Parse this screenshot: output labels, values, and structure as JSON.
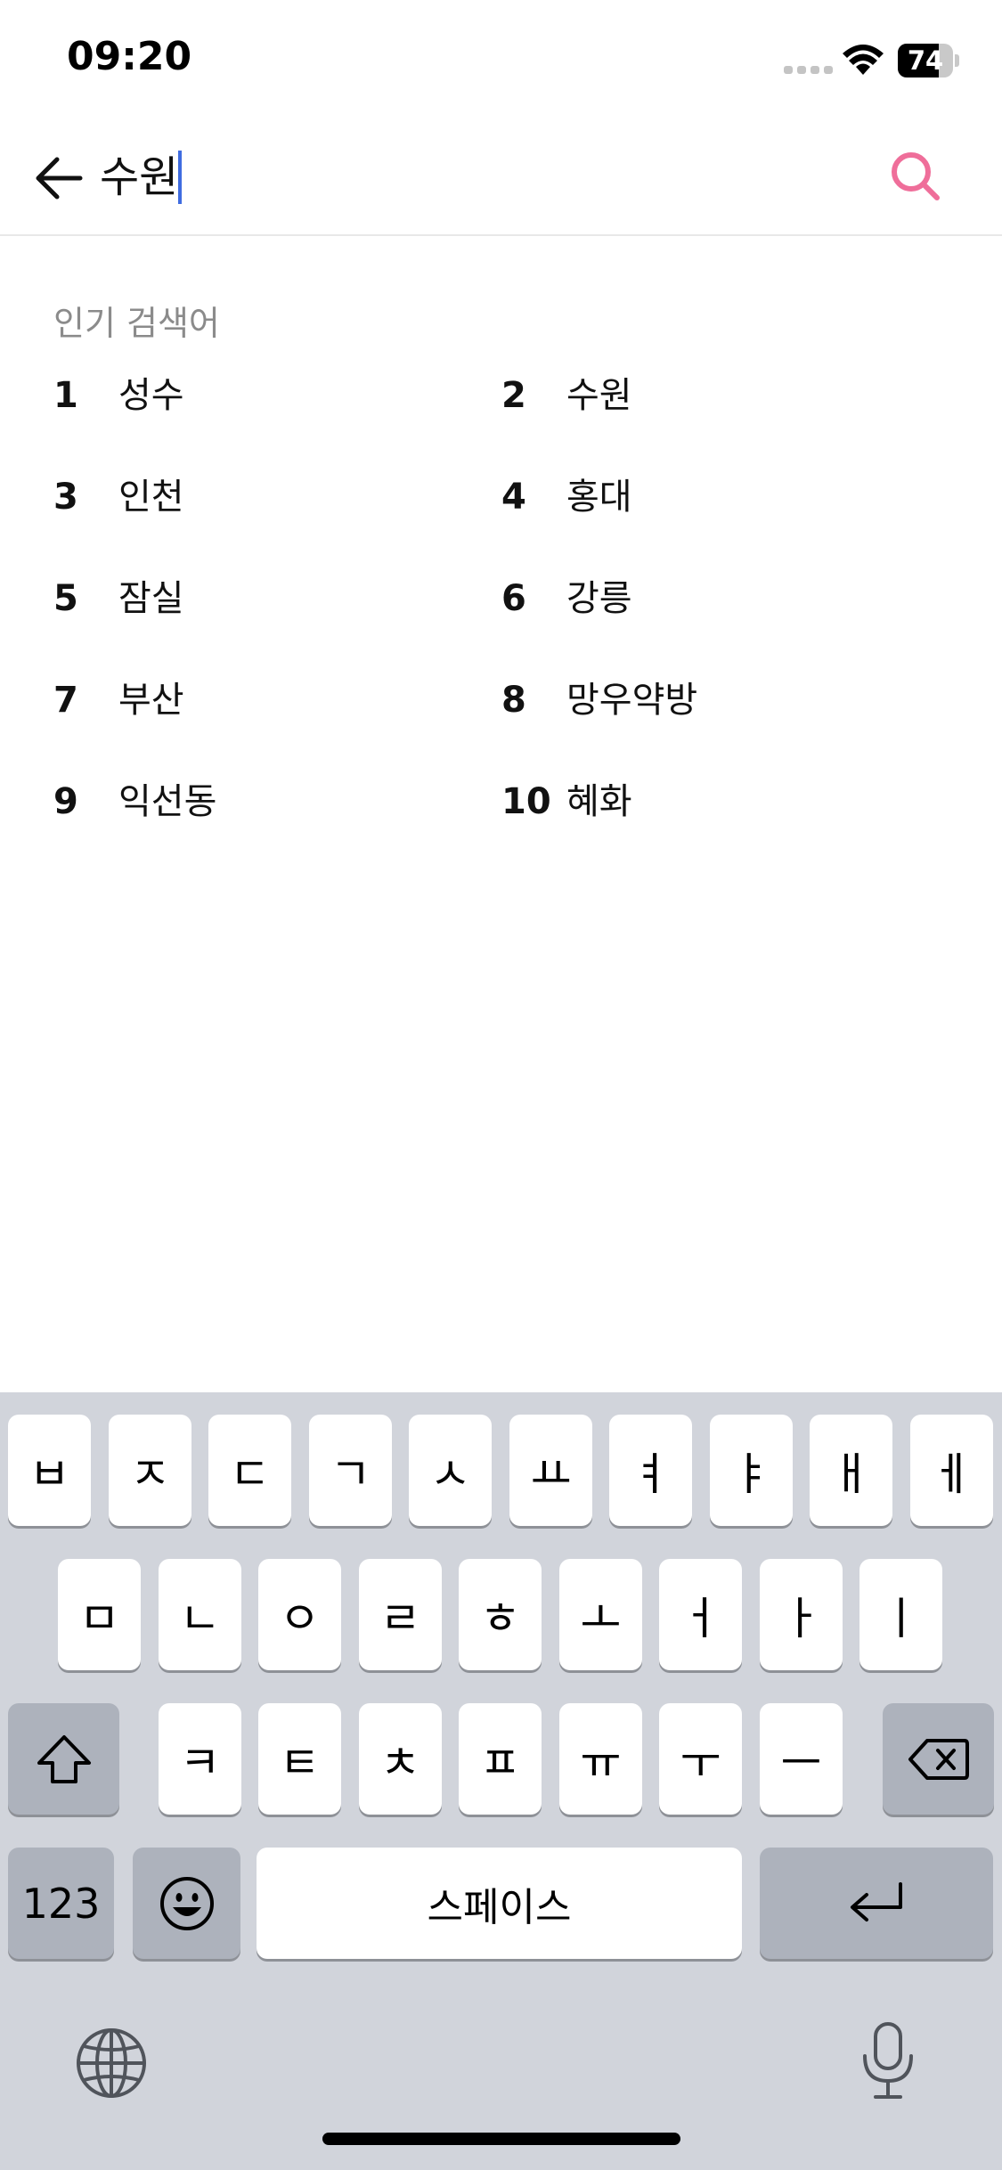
{
  "status_bar": {
    "time": "09:20",
    "battery_level": "74",
    "battery_fraction": 0.74
  },
  "search": {
    "value": "수원",
    "back_icon": "arrow-left-icon",
    "search_icon": "search-icon",
    "search_icon_color": "#ef6e9a"
  },
  "popular": {
    "title": "인기 검색어",
    "items": [
      {
        "rank": "1",
        "term": "성수"
      },
      {
        "rank": "2",
        "term": "수원"
      },
      {
        "rank": "3",
        "term": "인천"
      },
      {
        "rank": "4",
        "term": "홍대"
      },
      {
        "rank": "5",
        "term": "잠실"
      },
      {
        "rank": "6",
        "term": "강릉"
      },
      {
        "rank": "7",
        "term": "부산"
      },
      {
        "rank": "8",
        "term": "망우약방"
      },
      {
        "rank": "9",
        "term": "익선동"
      },
      {
        "rank": "10",
        "term": "혜화"
      }
    ]
  },
  "keyboard": {
    "row1": [
      "ㅂ",
      "ㅈ",
      "ㄷ",
      "ㄱ",
      "ㅅ",
      "ㅛ",
      "ㅕ",
      "ㅑ",
      "ㅐ",
      "ㅔ"
    ],
    "row2": [
      "ㅁ",
      "ㄴ",
      "ㅇ",
      "ㄹ",
      "ㅎ",
      "ㅗ",
      "ㅓ",
      "ㅏ",
      "ㅣ"
    ],
    "row3": [
      "ㅋ",
      "ㅌ",
      "ㅊ",
      "ㅍ",
      "ㅠ",
      "ㅜ",
      "ㅡ"
    ],
    "numbers_label": "123",
    "space_label": "스페이스",
    "shift_icon": "shift-icon",
    "delete_icon": "delete-icon",
    "emoji_icon": "emoji-icon",
    "return_icon": "return-icon",
    "globe_icon": "globe-icon",
    "mic_icon": "microphone-icon"
  }
}
